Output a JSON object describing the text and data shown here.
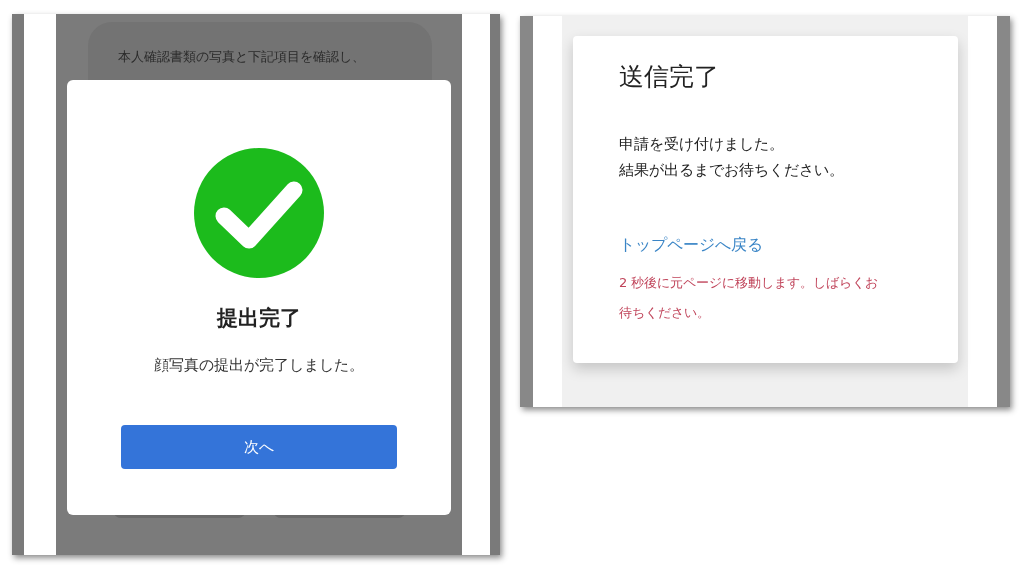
{
  "left_screen": {
    "background_text": "本人確認書類の写真と下記項目を確認し、",
    "dialog": {
      "title": "提出完了",
      "message": "顔写真の提出が完了しました。",
      "button": "次へ"
    }
  },
  "right_screen": {
    "title": "送信完了",
    "message_lines": [
      "申請を受け付けました。",
      "結果が出るまでお待ちください。"
    ],
    "link": "トップページへ戻る",
    "notice": "2 秒後に元ページに移動します。しばらくお待ちください。"
  }
}
